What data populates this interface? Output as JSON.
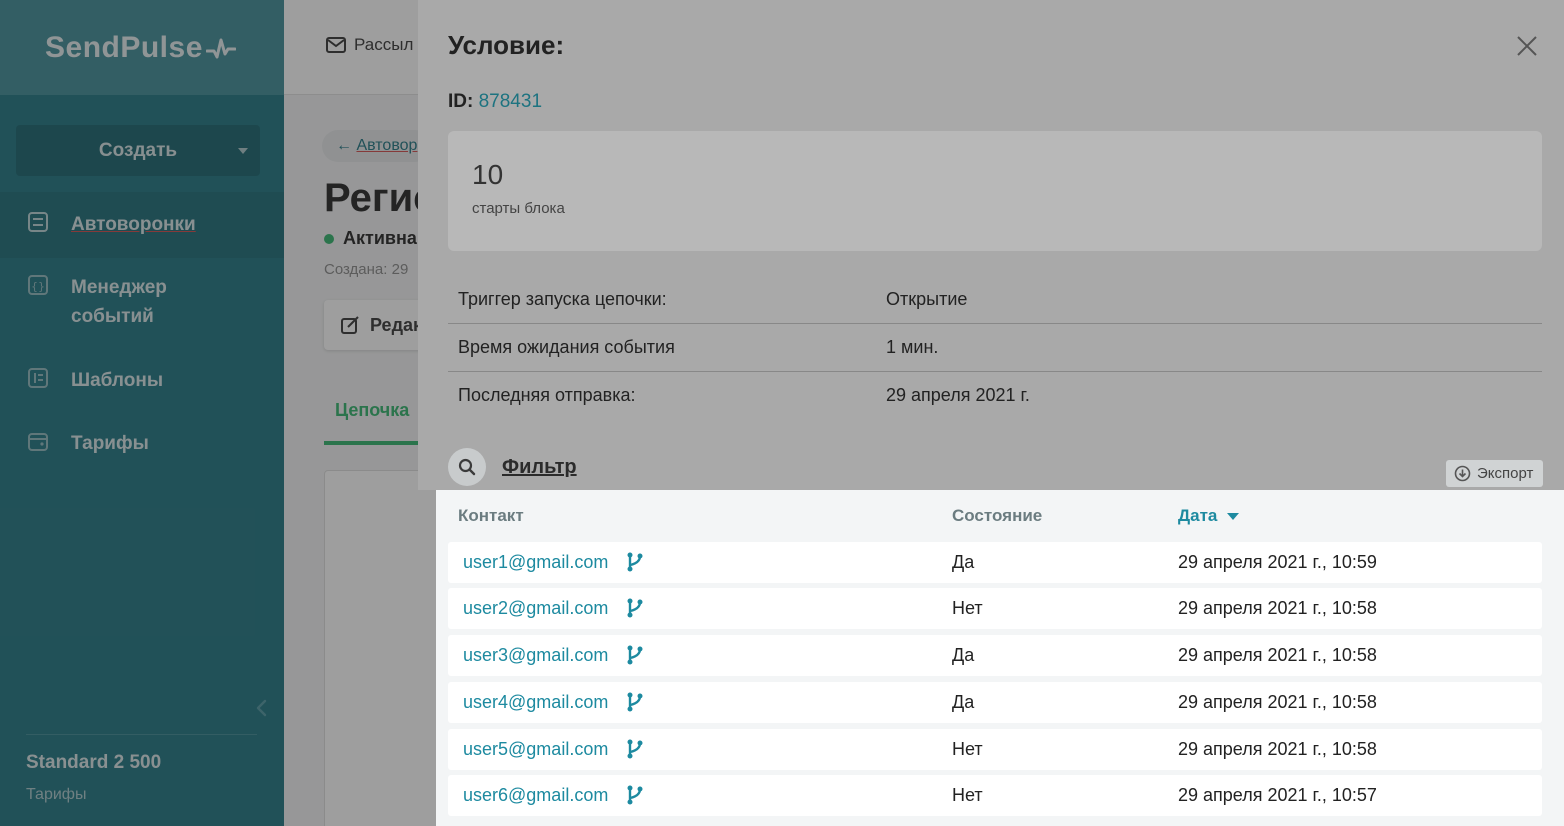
{
  "sidebar": {
    "logo": "SendPulse",
    "create_label": "Создать",
    "items": [
      {
        "label": "Автоворонки",
        "icon": "funnel-icon"
      },
      {
        "label": "Менеджер событий",
        "icon": "events-icon"
      },
      {
        "label": "Шаблоны",
        "icon": "templates-icon"
      },
      {
        "label": "Тарифы",
        "icon": "wallet-icon"
      }
    ],
    "plan_name": "Standard 2 500",
    "plan_link": "Тарифы"
  },
  "background": {
    "mail_link": "Рассыл",
    "back_link": "Автовор",
    "title": "Регис",
    "status": "Активна",
    "created": "Создана: 29",
    "edit_label": "Редак",
    "tab_label": "Цепочка"
  },
  "modal": {
    "title": "Условие:",
    "id_label": "ID:",
    "id_value": "878431",
    "stats_value": "10",
    "stats_label": "старты блока",
    "info": [
      {
        "key": "Триггер запуска цепочки:",
        "value": "Открытие"
      },
      {
        "key": "Время ожидания события",
        "value": "1 мин."
      },
      {
        "key": "Последняя отправка:",
        "value": "29 апреля 2021 г."
      }
    ],
    "filter_label": "Фильтр",
    "export_label": "Экспорт",
    "table": {
      "headers": {
        "contact": "Контакт",
        "state": "Состояние",
        "date": "Дата"
      },
      "rows": [
        {
          "email": "user1@gmail.com",
          "state": "Да",
          "date": "29 апреля 2021 г., 10:59"
        },
        {
          "email": "user2@gmail.com",
          "state": "Нет",
          "date": "29 апреля 2021 г., 10:58"
        },
        {
          "email": "user3@gmail.com",
          "state": "Да",
          "date": "29 апреля 2021 г., 10:58"
        },
        {
          "email": "user4@gmail.com",
          "state": "Да",
          "date": "29 апреля 2021 г., 10:58"
        },
        {
          "email": "user5@gmail.com",
          "state": "Нет",
          "date": "29 апреля 2021 г., 10:58"
        },
        {
          "email": "user6@gmail.com",
          "state": "Нет",
          "date": "29 апреля 2021 г., 10:57"
        }
      ]
    }
  },
  "colors": {
    "sidebar_bg": "#1d7380",
    "accent_link": "#1d8aa0",
    "active_green": "#2fb36a"
  }
}
